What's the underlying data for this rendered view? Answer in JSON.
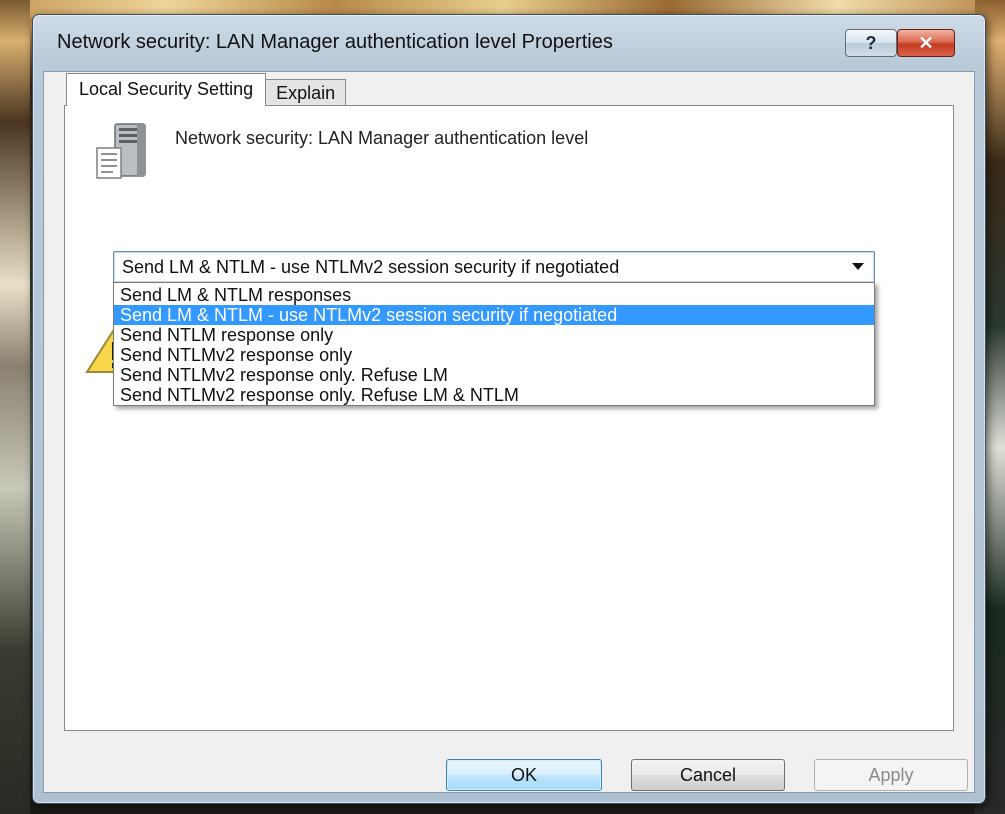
{
  "window": {
    "title": "Network security: LAN Manager authentication level Properties",
    "help_label": "?",
    "close_label": "✕"
  },
  "tabs": [
    {
      "label": "Local Security Setting",
      "active": true
    },
    {
      "label": "Explain",
      "active": false
    }
  ],
  "panel": {
    "policy_name": "Network security: LAN Manager authentication level",
    "icons": {
      "policy": "server-icon",
      "warning": "warning-icon"
    }
  },
  "dropdown": {
    "selected": "Send LM & NTLM - use NTLMv2 session security if negotiated",
    "options": [
      "Send LM & NTLM responses",
      "Send LM & NTLM - use NTLMv2 session security if negotiated",
      "Send NTLM response only",
      "Send NTLMv2 response only",
      "Send NTLMv2 response only. Refuse LM",
      "Send NTLMv2 response only. Refuse LM & NTLM"
    ],
    "highlighted_index": 1
  },
  "buttons": {
    "ok": "OK",
    "cancel": "Cancel",
    "apply": "Apply"
  },
  "colors": {
    "selection": "#3399ff",
    "close_button": "#c33d22",
    "ok_button": "#a7d9f5"
  }
}
